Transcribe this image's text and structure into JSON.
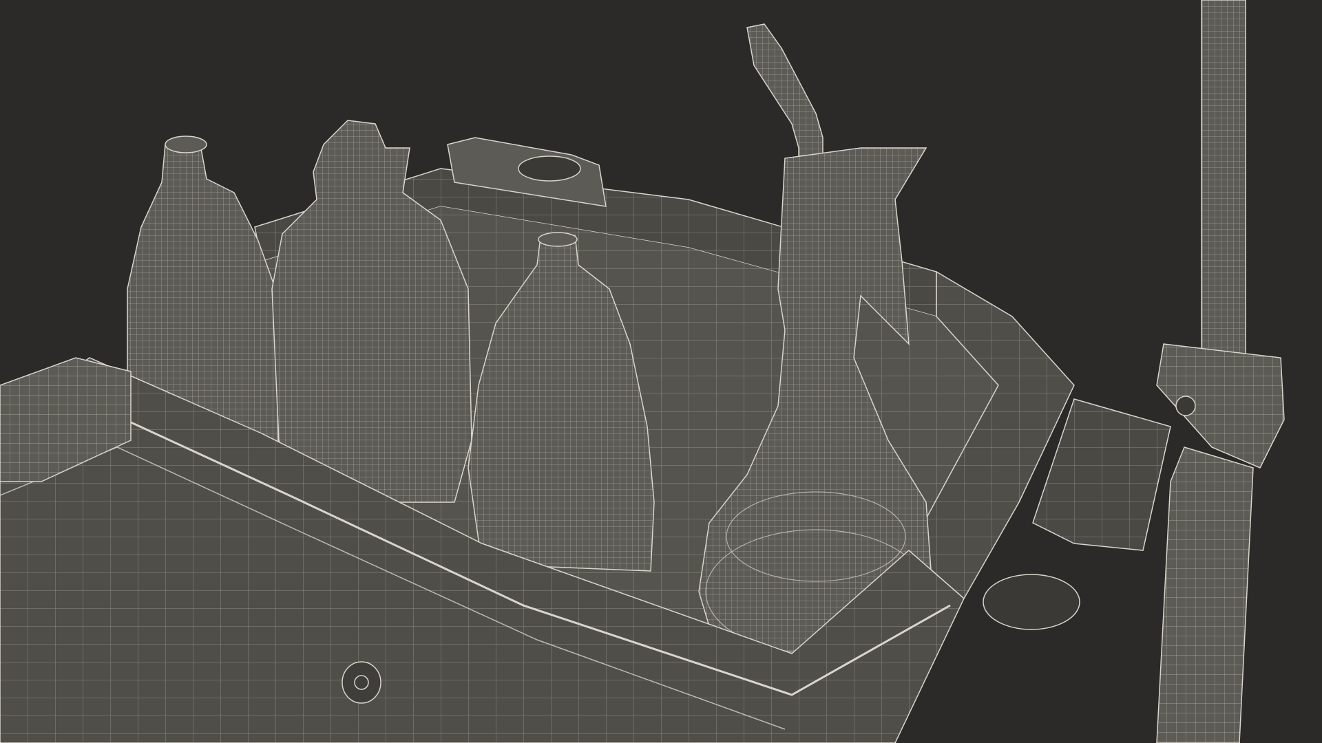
{
  "scene": {
    "background_color": "#2b2a28",
    "surface_color": "#5c5b55",
    "surface_dark_color": "#4a4944",
    "wire_color": "#d8d6cc",
    "objects": [
      "cleaning-caddy-tray",
      "dish-soap-bottle",
      "tall-shampoo-bottle",
      "small-dish-soap-bottle",
      "spray-bottle",
      "mop-handle",
      "vertical-pole"
    ]
  }
}
